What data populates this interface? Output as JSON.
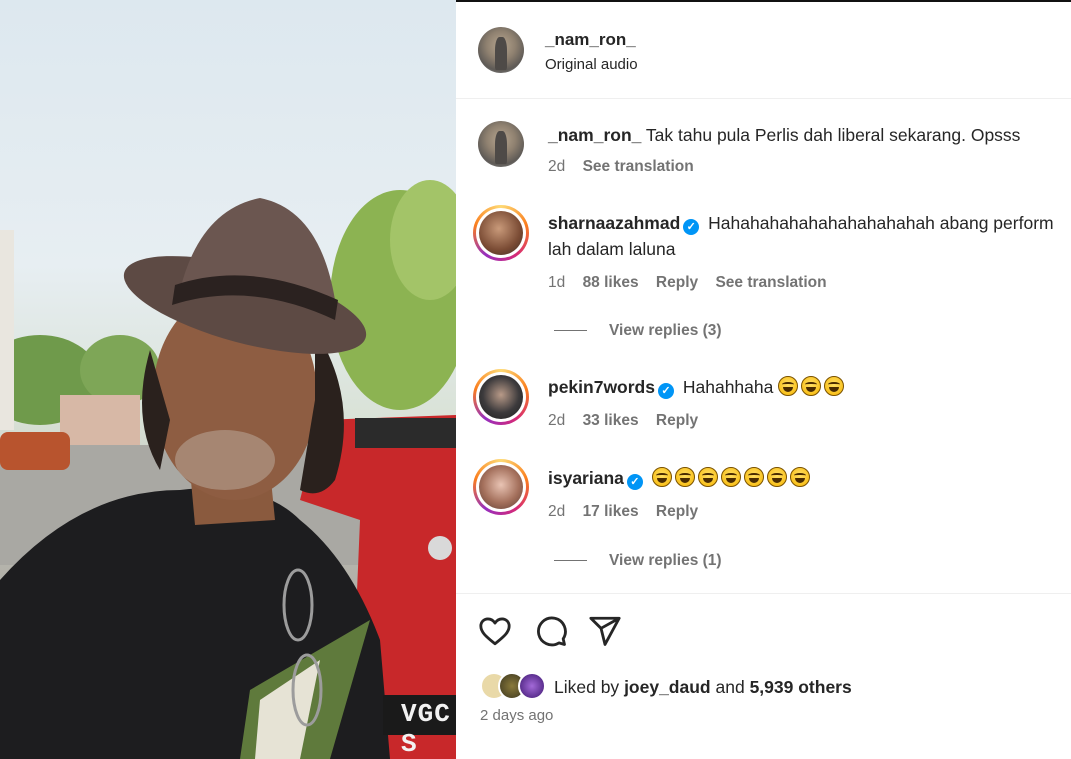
{
  "post": {
    "author": "_nam_ron_",
    "audio": "Original audio",
    "plate_text": "VGC S"
  },
  "comments": [
    {
      "username": "_nam_ron_",
      "text": "Tak tahu pula Perlis dah liberal sekarang. Opsss",
      "time": "2d",
      "likes": "",
      "reply": "",
      "translation": "See translation",
      "verified": false
    },
    {
      "username": "sharnaazahmad",
      "text": "Hahahahahahahahahahahah abang perform lah dalam laluna",
      "time": "1d",
      "likes": "88 likes",
      "reply": "Reply",
      "translation": "See translation",
      "verified": true,
      "view_replies": "View replies (3)"
    },
    {
      "username": "pekin7words",
      "text": "Hahahhaha",
      "emoji_count": 3,
      "time": "2d",
      "likes": "33 likes",
      "reply": "Reply",
      "verified": true
    },
    {
      "username": "isyariana",
      "text": "",
      "emoji_count": 7,
      "time": "2d",
      "likes": "17 likes",
      "reply": "Reply",
      "verified": true,
      "view_replies": "View replies (1)"
    }
  ],
  "footer": {
    "liked_by_prefix": "Liked by",
    "liked_by_user": "joey_daud",
    "and": "and",
    "others": "5,939 others",
    "time_ago": "2 days ago"
  },
  "icons": [
    "heart-icon",
    "comment-icon",
    "share-icon",
    "verified-badge-icon",
    "grinning-squinting-emoji"
  ],
  "colors": {
    "verified": "#0095f6",
    "muted_text": "#737373",
    "primary_text": "#262626",
    "story_ring_start": "#feda75",
    "story_ring_end": "#d62976"
  }
}
